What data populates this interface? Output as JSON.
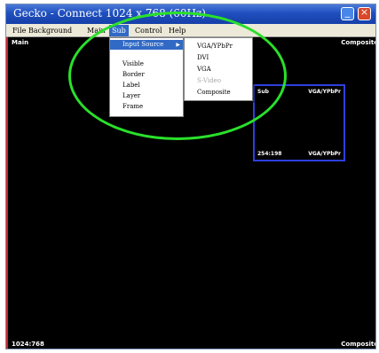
{
  "window": {
    "title": "Gecko - Connect 1024 x 768 (60Hz)",
    "minimize_glyph": "_",
    "close_glyph": "×"
  },
  "menubar": {
    "items": [
      "File",
      "Background",
      "Main",
      "Sub",
      "Control",
      "Help"
    ],
    "active_item": "Sub"
  },
  "canvas": {
    "top_left_label": "Main",
    "top_right_label": "Composite",
    "bottom_left_label": "1024:768",
    "bottom_right_label": "Composite"
  },
  "sub_window": {
    "top_left_label": "Sub",
    "top_right_label": "VGA/YPbPr",
    "bottom_left_label": "254:198",
    "bottom_right_label": "VGA/YPbPr"
  },
  "sub_menu": {
    "items": [
      "Input Source",
      "Visible",
      "Border",
      "Label",
      "Layer",
      "Frame"
    ],
    "highlighted": "Input Source",
    "submenu_arrow": "▶"
  },
  "input_source_menu": {
    "items": [
      "VGA/YPbPr",
      "DVI",
      "VGA",
      "S-Video",
      "Composite"
    ],
    "disabled": [
      "S-Video"
    ]
  },
  "colors": {
    "canvas_bg": "#000000",
    "highlight_ellipse": "#2ae02a",
    "sub_window_border": "#2f3fe0",
    "left_edge": "#d42020",
    "menu_highlight": "#316ac5"
  }
}
